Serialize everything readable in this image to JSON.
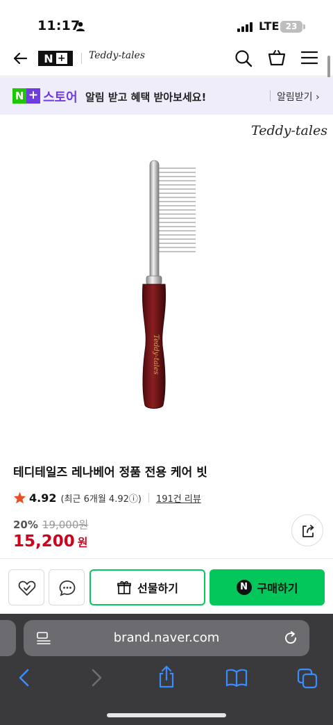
{
  "status_bar": {
    "time": "11:17",
    "network": "LTE",
    "battery": "23"
  },
  "nav": {
    "logo_text": "N",
    "brand_name": "Teddy-tales"
  },
  "banner": {
    "badge_n": "N",
    "badge_plus": "+",
    "store": "스토어",
    "message": "알림 받고 혜택 받아보세요!",
    "link": "알림받기 ›"
  },
  "product": {
    "brand_mark": "Teddy-tales",
    "title": "테디테일즈 레나베어 정품 전용 케어 빗",
    "rating": "4.92",
    "rating_recent": "(최근 6개월 4.92ⓘ)",
    "reviews": "191건 리뷰",
    "discount": "20%",
    "original_price": "19,000원",
    "sale_price": "15,200",
    "currency": "원"
  },
  "actions": {
    "gift": "선물하기",
    "buy": "구매하기",
    "buy_badge": "N"
  },
  "browser": {
    "url": "brand.naver.com"
  },
  "colors": {
    "naver_green": "#03c75a",
    "plus_purple": "#6f3dde",
    "sale_red": "#d0021b",
    "star": "#e8502a"
  }
}
